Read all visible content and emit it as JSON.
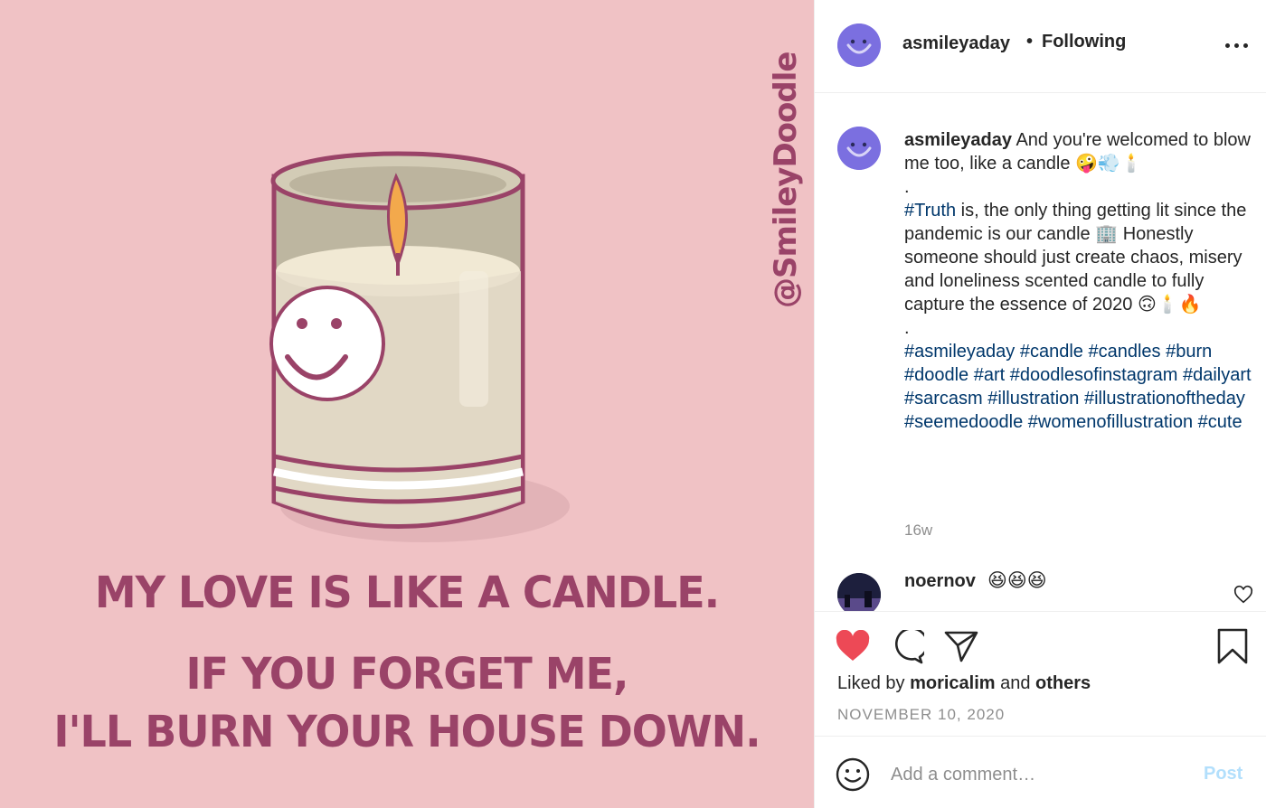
{
  "image": {
    "line1": "My love is like a candle.",
    "line2": "If you forget me,",
    "line3": "I'll burn your house down.",
    "watermark": "@SmileyDoodle",
    "colors": {
      "background": "#f0c2c5",
      "ink": "#9a4368",
      "jar": "#bfb7a0",
      "wax": "#ece3cf",
      "flame": "#f0a44a"
    }
  },
  "header": {
    "username": "asmileyaday",
    "separator": "•",
    "following": "Following",
    "more_icon": "more-horizontal-icon"
  },
  "caption": {
    "username": "asmileyaday",
    "line1": "And you're welcomed to blow me too, like a candle 🤪💨🕯️",
    "dot1": ".",
    "tag_truth": "#Truth",
    "line2": " is, the only thing getting lit since the pandemic is our candle 🏢 Honestly someone should just create chaos, misery and loneliness scented candle to fully capture the essence of 2020 🙃🕯️🔥",
    "dot2": ".",
    "hashtags": "#asmileyaday #candle #candles #burn #doodle #art #doodlesofinstagram #dailyart #sarcasm #illustration #illustrationoftheday #seemedoodle #womenofillustration #cute",
    "time": "16w"
  },
  "comment": {
    "username": "noernov",
    "text": "😆😆😆",
    "like_icon": "heart-outline-icon"
  },
  "actions": {
    "liked_by_prefix": "Liked by",
    "liked_by_user": "moricalim",
    "liked_by_and": "and",
    "liked_by_others": "others",
    "date": "NOVEMBER 10, 2020",
    "like_color": "#ed4956"
  },
  "composer": {
    "placeholder": "Add a comment…",
    "post_label": "Post",
    "post_color": "#b2dffc"
  }
}
